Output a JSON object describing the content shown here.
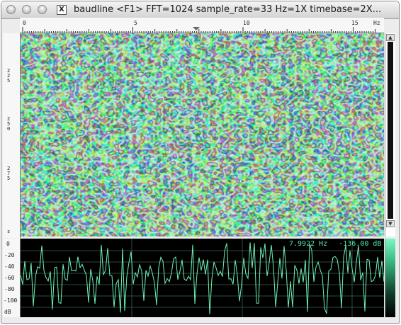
{
  "window": {
    "title": "baudline  <F1> FFT=1024 sample_rate=33 Hz=1X timebase=2X...",
    "x11_icon_label": "X"
  },
  "top_ruler": {
    "labels": [
      "0",
      "5",
      "10",
      "15"
    ],
    "unit": "Hz"
  },
  "left_ruler": {
    "time_labels": [
      "2\n2\n5",
      "2\n5\n0",
      "2\n7\n5"
    ],
    "bottom_label": "s"
  },
  "scrollbar": {
    "up_arrow": "▲",
    "down_arrow": "▼"
  },
  "spectrum": {
    "readout_freq": "7.9922 Hz",
    "readout_db": "-136.00 dB",
    "db_labels": [
      "0",
      "-20",
      "-40",
      "-60",
      "-80",
      "-100",
      "dB"
    ]
  },
  "colors": {
    "accent": "#4fe8a6",
    "trace": "#6ff3b5",
    "background": "#000000"
  }
}
